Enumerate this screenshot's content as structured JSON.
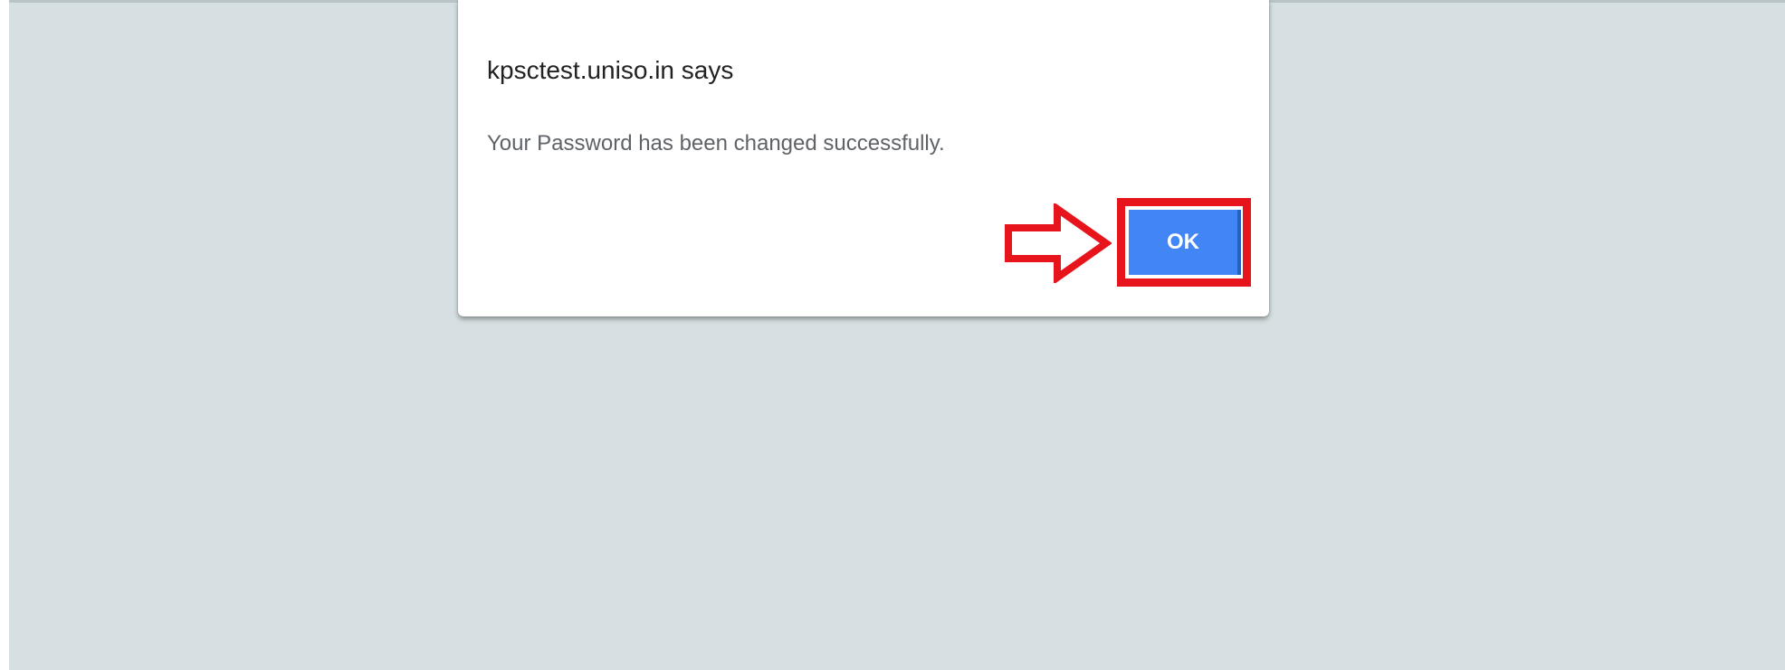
{
  "dialog": {
    "title": "kpsctest.uniso.in says",
    "message": "Your Password has been changed successfully.",
    "ok_label": "OK"
  },
  "annotation": {
    "arrow_icon": "right-arrow-icon",
    "highlight_color": "#e8141c"
  },
  "colors": {
    "backdrop": "#d6e0e2",
    "button": "#4285f4"
  }
}
